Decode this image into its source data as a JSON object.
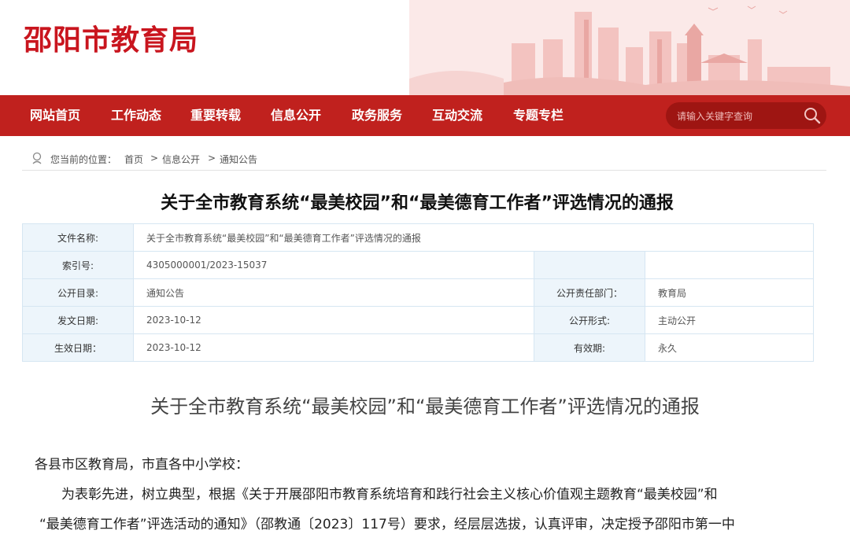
{
  "site": {
    "title": "邵阳市教育局"
  },
  "nav": {
    "items": [
      "网站首页",
      "工作动态",
      "重要转载",
      "信息公开",
      "政务服务",
      "互动交流",
      "专题专栏"
    ],
    "search_placeholder": "请输入关键字查询"
  },
  "breadcrumb": {
    "prefix": "您当前的位置：",
    "items": [
      "首页",
      "信息公开",
      "通知公告"
    ],
    "separator": ">"
  },
  "doc": {
    "title": "关于全市教育系统“最美校园”和“最美德育工作者”评选情况的通报"
  },
  "meta": {
    "file_name_label": "文件名称:",
    "file_name_value": "关于全市教育系统“最美校园”和“最美德育工作者”评选情况的通报",
    "index_label": "索引号:",
    "index_value": "4305000001/2023-15037",
    "catalog_label": "公开目录:",
    "catalog_value": "通知公告",
    "dept_label": "公开责任部门：",
    "dept_value": "教育局",
    "date_label": "发文日期:",
    "date_value": "2023-10-12",
    "form_label": "公开形式:",
    "form_value": "主动公开",
    "effective_label": "生效日期：",
    "effective_value": "2023-10-12",
    "validity_label": "有效期:",
    "validity_value": "永久"
  },
  "article": {
    "title": "关于全市教育系统“最美校园”和“最美德育工作者”评选情况的通报",
    "salutation": "各县市区教育局，市直各中小学校：",
    "line1": "为表彰先进，树立典型，根据《关于开展邵阳市教育系统培育和践行社会主义核心价值观主题教育“最美校园”和",
    "line2": "“最美德育工作者”评选活动的通知》（邵教通〔2023〕117号）要求，经层层选拔，认真评审，决定授予邵阳市第一中"
  }
}
